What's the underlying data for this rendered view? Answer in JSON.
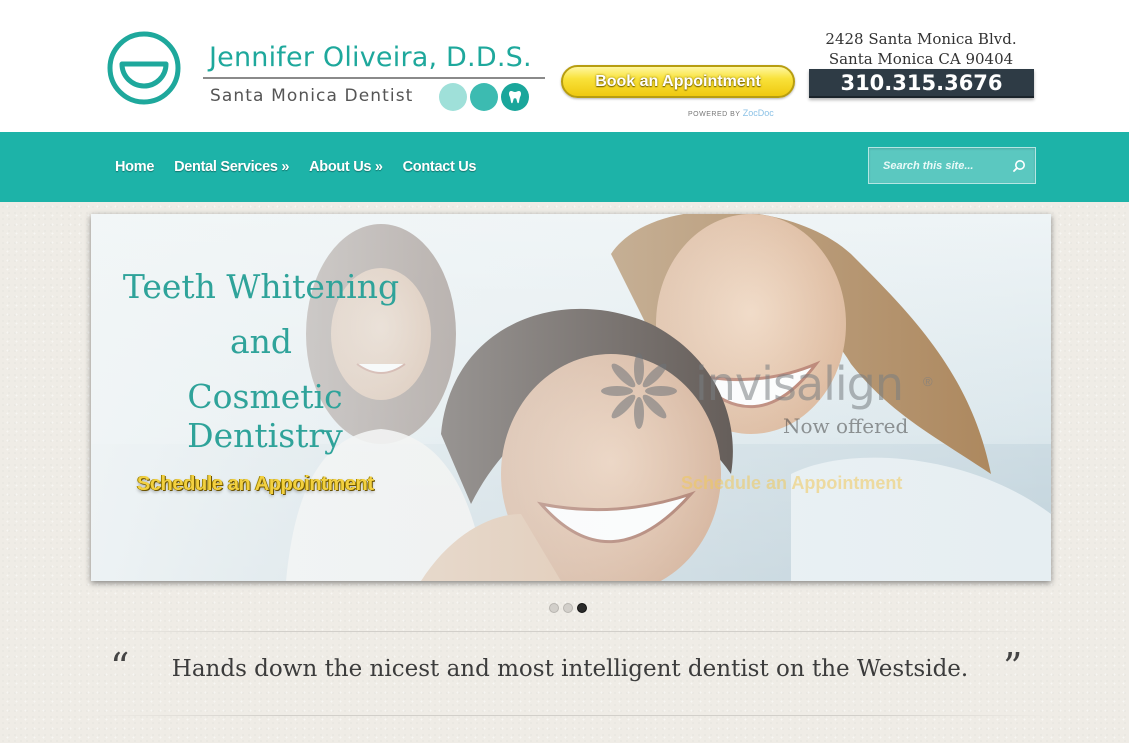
{
  "brand": {
    "name": "Jennifer Oliveira, D.D.S.",
    "subtitle": "Santa Monica Dentist",
    "accent_color": "#1db3a8"
  },
  "booking": {
    "label": "Book an Appointment",
    "powered_prefix": "POWERED BY",
    "powered_by": "ZocDoc"
  },
  "contact": {
    "address_line1": "2428 Santa Monica Blvd.",
    "address_line2": "Santa Monica CA 90404",
    "phone": "310.315.3676"
  },
  "nav": {
    "items": [
      {
        "label": "Home"
      },
      {
        "label": "Dental Services »"
      },
      {
        "label": "About Us »"
      },
      {
        "label": "Contact Us"
      }
    ],
    "search_placeholder": "Search this site..."
  },
  "slider": {
    "headline_lines": [
      "Teeth Whitening",
      "and",
      "Cosmetic Dentistry"
    ],
    "cta": "Schedule an Appointment",
    "overlay_brand": "invisalign",
    "overlay_reg": "®",
    "overlay_sub": "Now offered",
    "overlay_cta": "Schedule an Appointment",
    "slide_count": 3,
    "active_slide": 3
  },
  "testimonial": {
    "open_quote": "“",
    "close_quote": "”",
    "text": "Hands down the nicest and most intelligent dentist on the Westside."
  }
}
